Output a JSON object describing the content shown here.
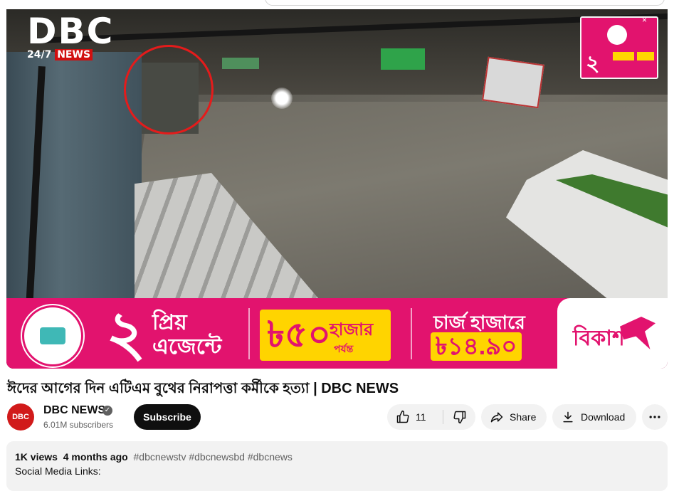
{
  "video": {
    "overlay_logo": {
      "brand": "DBC",
      "tag_prefix": "24/7",
      "tag_news": "NEWS"
    },
    "banner": {
      "big_number": "২",
      "headline": "প্রিয় এজেন্টে",
      "amount": "৳৫০",
      "amount_unit": "হাজার",
      "amount_suffix": "পর্যন্ত",
      "charge_label": "চার্জ হাজারে",
      "charge_value": "৳১৪.৯০",
      "brand": "বিকাশ"
    },
    "corner_ad": {
      "close_glyph": "×"
    }
  },
  "title": "ঈদের আগের দিন এটিএম বুথের নিরাপত্তা কর্মীকে হত্যা | DBC NEWS",
  "channel": {
    "name": "DBC NEWS",
    "avatar_text": "DBC",
    "verified_glyph": "✓",
    "subscribers": "6.01M subscribers",
    "subscribe_label": "Subscribe"
  },
  "actions": {
    "like_count": "11",
    "share_label": "Share",
    "download_label": "Download",
    "icons": [
      "thumbs-up-icon",
      "thumbs-down-icon",
      "share-icon",
      "download-icon",
      "more-icon"
    ]
  },
  "description": {
    "views": "1K views",
    "age": "4 months ago",
    "hashtags": "#dbcnewstv #dbcnewsbd #dbcnews",
    "line2": "Social Media Links:",
    "line3": ""
  },
  "colors": {
    "bkash_pink": "#e2136e",
    "bkash_yellow": "#ffd400",
    "highlight_circle": "#e41b1b",
    "subscribe_bg": "#0f0f0f"
  }
}
